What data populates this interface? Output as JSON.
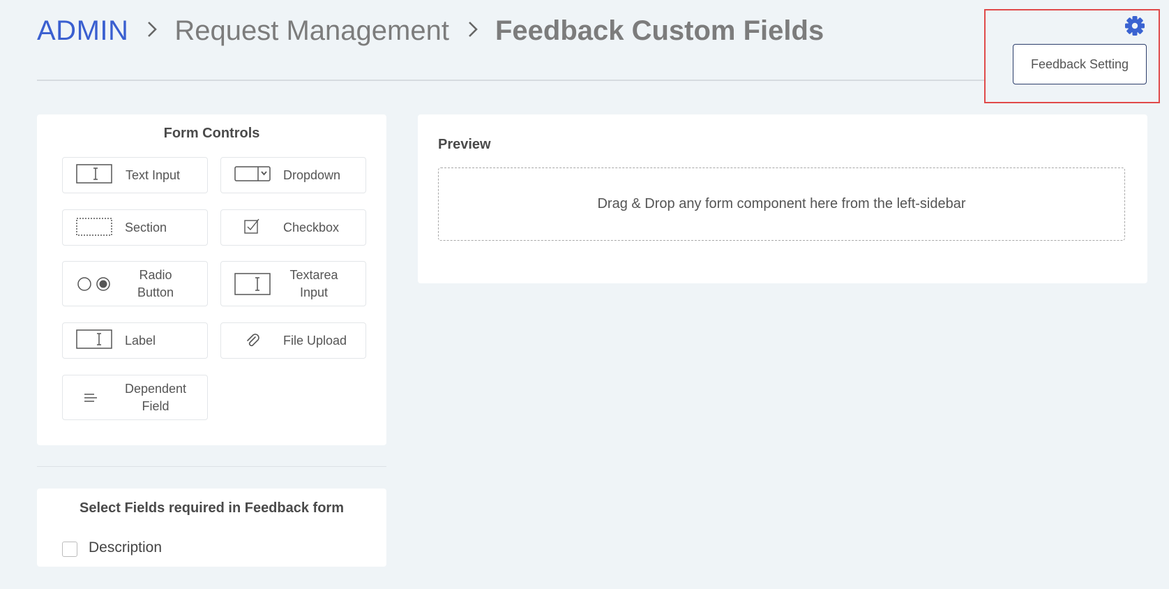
{
  "breadcrumb": {
    "admin": "ADMIN",
    "middle": "Request Management",
    "current": "Feedback Custom Fields",
    "separator": ">"
  },
  "settings": {
    "gear_icon": "gear-icon",
    "feedback_setting_label": "Feedback Setting"
  },
  "form_controls": {
    "title": "Form Controls",
    "items": [
      {
        "label": "Text Input",
        "icon": "text-input-icon"
      },
      {
        "label": "Dropdown",
        "icon": "dropdown-icon"
      },
      {
        "label": "Section",
        "icon": "section-icon"
      },
      {
        "label": "Checkbox",
        "icon": "checkbox-icon"
      },
      {
        "label": "Radio Button",
        "icon": "radio-button-icon"
      },
      {
        "label": "Textarea Input",
        "icon": "textarea-icon"
      },
      {
        "label": "Label",
        "icon": "label-icon"
      },
      {
        "label": "File Upload",
        "icon": "paperclip-icon"
      },
      {
        "label": "Dependent Field",
        "icon": "lines-icon"
      }
    ]
  },
  "preview": {
    "title": "Preview",
    "dropzone_text": "Drag & Drop any form component here from the left-sidebar"
  },
  "required_fields": {
    "title": "Select Fields required in Feedback form",
    "items": [
      {
        "label": "Description",
        "checked": false
      }
    ]
  },
  "colors": {
    "accent": "#3a5fd0",
    "background": "#eff4f7",
    "highlight_border": "#e04a4a"
  }
}
